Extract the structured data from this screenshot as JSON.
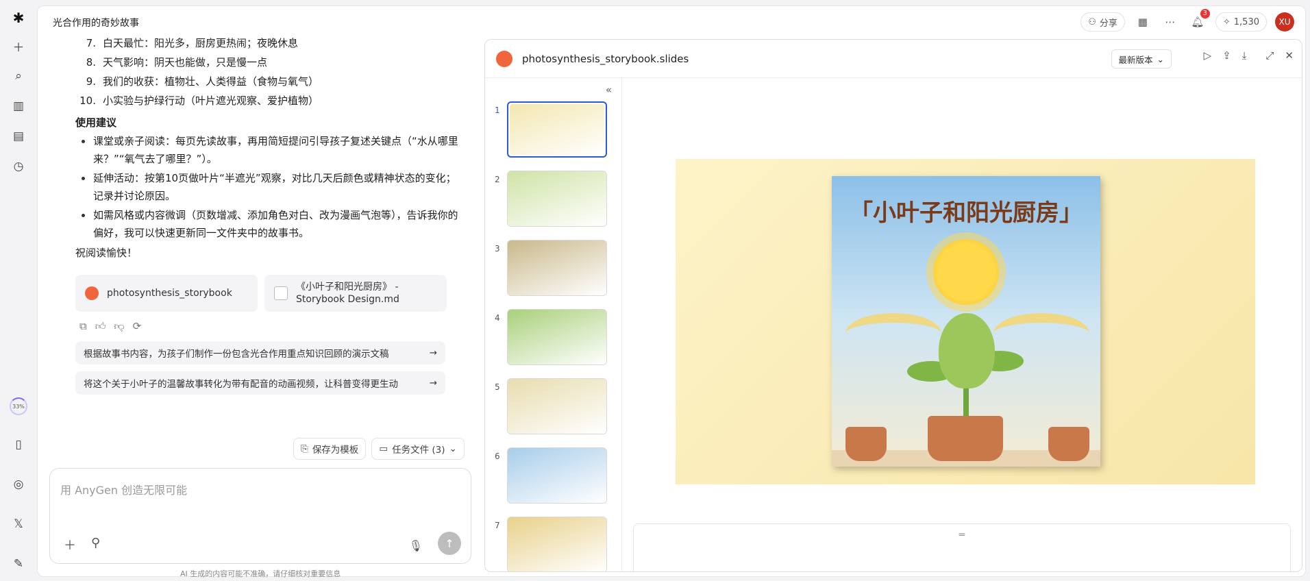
{
  "app": {
    "conversation_title": "光合作用的奇妙故事",
    "share_label": "分享",
    "notification_count": "3",
    "credits": "1,530",
    "avatar_initials": "XU",
    "usage_percent": "33%"
  },
  "chat": {
    "ordered_items": [
      {
        "n": "7.",
        "text": "白天最忙：阳光多，厨房更热闹；夜晚休息"
      },
      {
        "n": "8.",
        "text": "天气影响：阴天也能做，只是慢一点"
      },
      {
        "n": "9.",
        "text": "我们的收获：植物壮、人类得益（食物与氧气）"
      },
      {
        "n": "10.",
        "text": "小实验与护绿行动（叶片遮光观察、爱护植物）"
      }
    ],
    "section_heading": "使用建议",
    "bullets": [
      "课堂或亲子阅读：每页先读故事，再用简短提问引导孩子复述关键点（“水从哪里来？”“氧气去了哪里？”）。",
      "延伸活动：按第10页做叶片“半遮光”观察，对比几天后颜色或精神状态的变化；记录并讨论原因。",
      "如需风格或内容微调（页数增减、添加角色对白、改为漫画气泡等），告诉我你的偏好，我可以快速更新同一文件夹中的故事书。"
    ],
    "closing": "祝阅读愉快！",
    "files": [
      {
        "name": "photosynthesis_storybook",
        "type": "slides"
      },
      {
        "name": "《小叶子和阳光厨房》 - Storybook Design.md",
        "type": "doc"
      }
    ],
    "suggestions": [
      "根据故事书内容，为孩子们制作一份包含光合作用重点知识回顾的演示文稿",
      "将这个关于小叶子的温馨故事转化为带有配音的动画视频，让科普变得更生动"
    ],
    "save_template_label": "保存为模板",
    "task_files_label": "任务文件 (3)",
    "input_placeholder": "用 AnyGen 创造无限可能",
    "disclaimer": "AI 生成的内容可能不准确，请仔细核对重要信息"
  },
  "slides_panel": {
    "file_name": "photosynthesis_storybook.slides",
    "version_label": "最新版本",
    "thumbnails": [
      {
        "num": "1",
        "active": true,
        "color": "#f3e7b0"
      },
      {
        "num": "2",
        "active": false,
        "color": "#cfe3a6"
      },
      {
        "num": "3",
        "active": false,
        "color": "#c9b88a"
      },
      {
        "num": "4",
        "active": false,
        "color": "#a9d07a"
      },
      {
        "num": "5",
        "active": false,
        "color": "#e8dcae"
      },
      {
        "num": "6",
        "active": false,
        "color": "#a8cdea"
      },
      {
        "num": "7",
        "active": false,
        "color": "#e8d18a"
      }
    ],
    "current_slide_title": "「小叶子和阳光厨房」"
  }
}
